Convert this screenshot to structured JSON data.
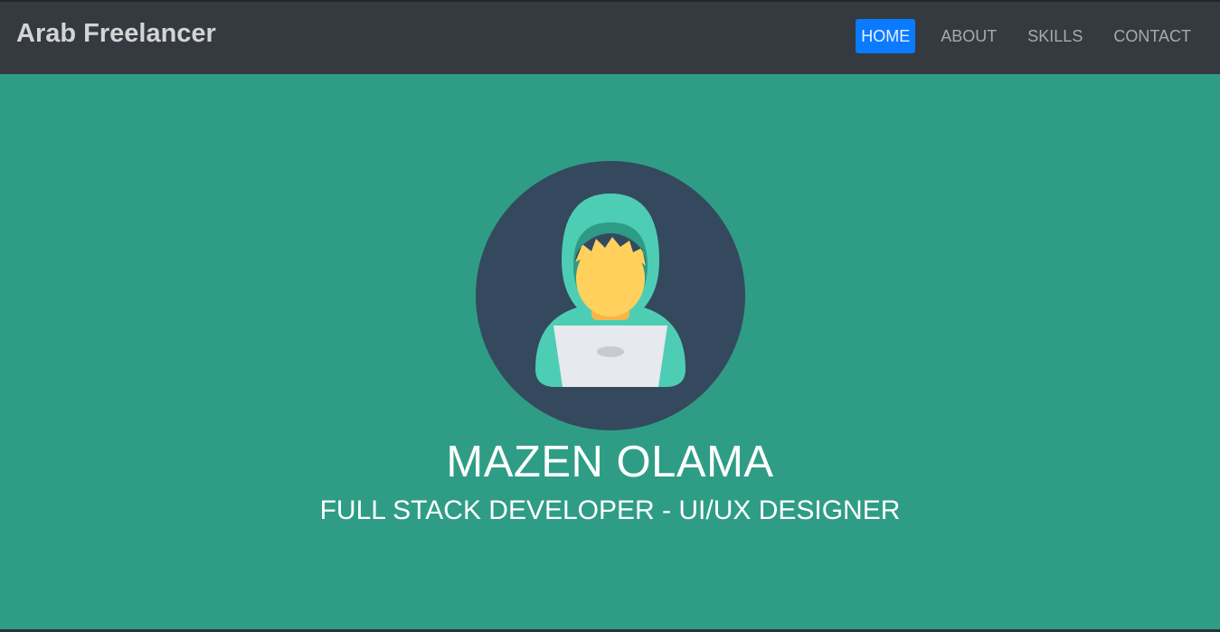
{
  "brand": "Arab Freelancer",
  "nav": [
    {
      "label": "HOME",
      "active": true
    },
    {
      "label": "ABOUT",
      "active": false
    },
    {
      "label": "SKILLS",
      "active": false
    },
    {
      "label": "CONTACT",
      "active": false
    }
  ],
  "hero": {
    "avatar_icon": "hooded-developer-laptop-icon",
    "name": "MAZEN OLAMA",
    "subtitle": "FULL STACK DEVELOPER - UI/UX DESIGNER"
  },
  "colors": {
    "navbar": "#343a40",
    "hero_background": "#2f9d86",
    "active_nav": "#0a7bff",
    "avatar_circle": "#34495e",
    "hood": "#4ecdb5",
    "face": "#ffd15c",
    "laptop": "#e6e9ee"
  }
}
